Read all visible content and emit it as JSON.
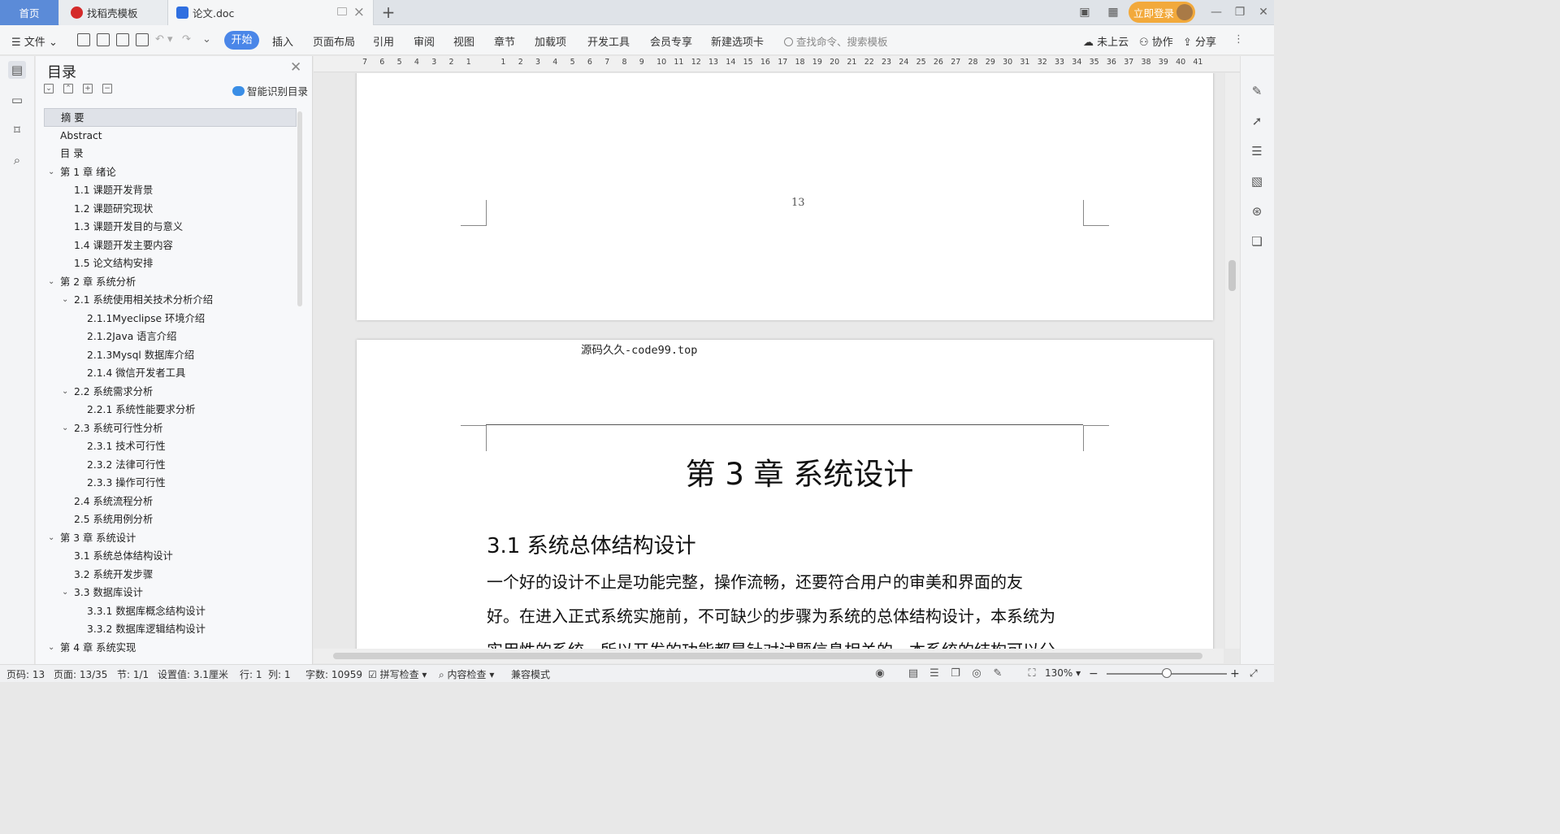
{
  "tabs": {
    "home": "首页",
    "templates": "找稻壳模板",
    "doc": "论文.doc",
    "add": "+"
  },
  "login": "立即登录",
  "toolbar": {
    "file": "文件",
    "ribbon_tabs": [
      "开始",
      "插入",
      "页面布局",
      "引用",
      "审阅",
      "视图",
      "章节",
      "加载项",
      "开发工具",
      "会员专享",
      "新建选项卡"
    ],
    "search_placeholder": "查找命令、搜索模板",
    "cloud": "未上云",
    "collab": "协作",
    "share": "分享"
  },
  "toc": {
    "title": "目录",
    "smart": "智能识别目录",
    "items": [
      {
        "text": "摘  要",
        "level": 1,
        "chev": false,
        "selected": true
      },
      {
        "text": "Abstract",
        "level": 1,
        "chev": false
      },
      {
        "text": "目  录",
        "level": 1,
        "chev": false
      },
      {
        "text": "第 1 章   绪论",
        "level": 1,
        "chev": true
      },
      {
        "text": "1.1 课题开发背景",
        "level": 2,
        "chev": false
      },
      {
        "text": "1.2 课题研究现状",
        "level": 2,
        "chev": false
      },
      {
        "text": "1.3 课题开发目的与意义",
        "level": 2,
        "chev": false
      },
      {
        "text": "1.4 课题开发主要内容",
        "level": 2,
        "chev": false
      },
      {
        "text": "1.5 论文结构安排",
        "level": 2,
        "chev": false
      },
      {
        "text": "第 2 章  系统分析",
        "level": 1,
        "chev": true
      },
      {
        "text": "2.1 系统使用相关技术分析介绍",
        "level": 2,
        "chev": true
      },
      {
        "text": "2.1.1Myeclipse 环境介绍",
        "level": 3,
        "chev": false
      },
      {
        "text": "2.1.2Java 语言介绍",
        "level": 3,
        "chev": false
      },
      {
        "text": " 2.1.3Mysql 数据库介绍",
        "level": 3,
        "chev": false
      },
      {
        "text": "2.1.4 微信开发者工具",
        "level": 3,
        "chev": false
      },
      {
        "text": "2.2 系统需求分析",
        "level": 2,
        "chev": true
      },
      {
        "text": "2.2.1 系统性能要求分析",
        "level": 3,
        "chev": false
      },
      {
        "text": "2.3 系统可行性分析",
        "level": 2,
        "chev": true
      },
      {
        "text": "2.3.1 技术可行性",
        "level": 3,
        "chev": false
      },
      {
        "text": "2.3.2 法律可行性",
        "level": 3,
        "chev": false
      },
      {
        "text": "2.3.3 操作可行性",
        "level": 3,
        "chev": false
      },
      {
        "text": "2.4 系统流程分析",
        "level": 2,
        "chev": false
      },
      {
        "text": "2.5 系统用例分析",
        "level": 2,
        "chev": false
      },
      {
        "text": "第 3 章  系统设计",
        "level": 1,
        "chev": true
      },
      {
        "text": "3.1 系统总体结构设计",
        "level": 2,
        "chev": false
      },
      {
        "text": "3.2 系统开发步骤",
        "level": 2,
        "chev": false
      },
      {
        "text": "3.3 数据库设计",
        "level": 2,
        "chev": true
      },
      {
        "text": "3.3.1 数据库概念结构设计",
        "level": 3,
        "chev": false
      },
      {
        "text": "3.3.2 数据库逻辑结构设计",
        "level": 3,
        "chev": false
      },
      {
        "text": "第 4 章  系统实现",
        "level": 1,
        "chev": true
      }
    ]
  },
  "ruler_ticks": [
    "7",
    "6",
    "5",
    "4",
    "3",
    "2",
    "1",
    "",
    "1",
    "2",
    "3",
    "4",
    "5",
    "6",
    "7",
    "8",
    "9",
    "10",
    "11",
    "12",
    "13",
    "14",
    "15",
    "16",
    "17",
    "18",
    "19",
    "20",
    "21",
    "22",
    "23",
    "24",
    "25",
    "26",
    "27",
    "28",
    "29",
    "30",
    "31",
    "32",
    "33",
    "34",
    "35",
    "36",
    "37",
    "38",
    "39",
    "40",
    "41"
  ],
  "document": {
    "page_number": "13",
    "watermark": "源码久久-code99.top",
    "chapter_title": "第 3 章  系统设计",
    "section_title": "3.1 系统总体结构设计",
    "para_line1": "    一个好的设计不止是功能完整，操作流畅，还要符合用户的审美和界面的友",
    "para_line2": "好。在进入正式系统实施前，不可缺少的步骤为系统的总体结构设计，本系统为",
    "para_line3": "实用性的系统，所以开发的功能都是针对试题信息相关的，本系统的结构可以分"
  },
  "status": {
    "page_code": "页码: 13",
    "page": "页面: 13/35",
    "section": "节: 1/1",
    "setting": "设置值: 3.1厘米",
    "row": "行: 1",
    "col": "列: 1",
    "words": "字数: 10959",
    "spell": "拼写检查",
    "content_check": "内容检查",
    "compat": "兼容模式",
    "zoom": "130%"
  },
  "colors": {
    "accent": "#4a86e8",
    "login": "#f2a93b",
    "home_tab": "#5b8bd8"
  }
}
